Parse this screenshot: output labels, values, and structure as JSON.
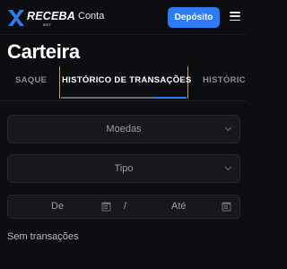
{
  "header": {
    "logo_text": "RECEBA",
    "logo_sub": "BET",
    "account_link": "Conta",
    "deposit_button": "Depósito"
  },
  "page": {
    "title": "Carteira"
  },
  "tabs": [
    {
      "label": "SAQUE",
      "active": false
    },
    {
      "label": "HISTÓRICO DE TRANSAÇÕES",
      "active": true
    },
    {
      "label": "HISTÓRIC",
      "active": false
    }
  ],
  "filters": {
    "currency": {
      "label": "Moedas"
    },
    "type": {
      "label": "Tipo"
    },
    "date_from": {
      "label": "De"
    },
    "separator": "/",
    "date_to": {
      "label": "Até"
    }
  },
  "empty_state": "Sem transações",
  "colors": {
    "accent": "#2d7bf6",
    "background": "#0c0d10",
    "tab_frame": "#c9a04a"
  }
}
